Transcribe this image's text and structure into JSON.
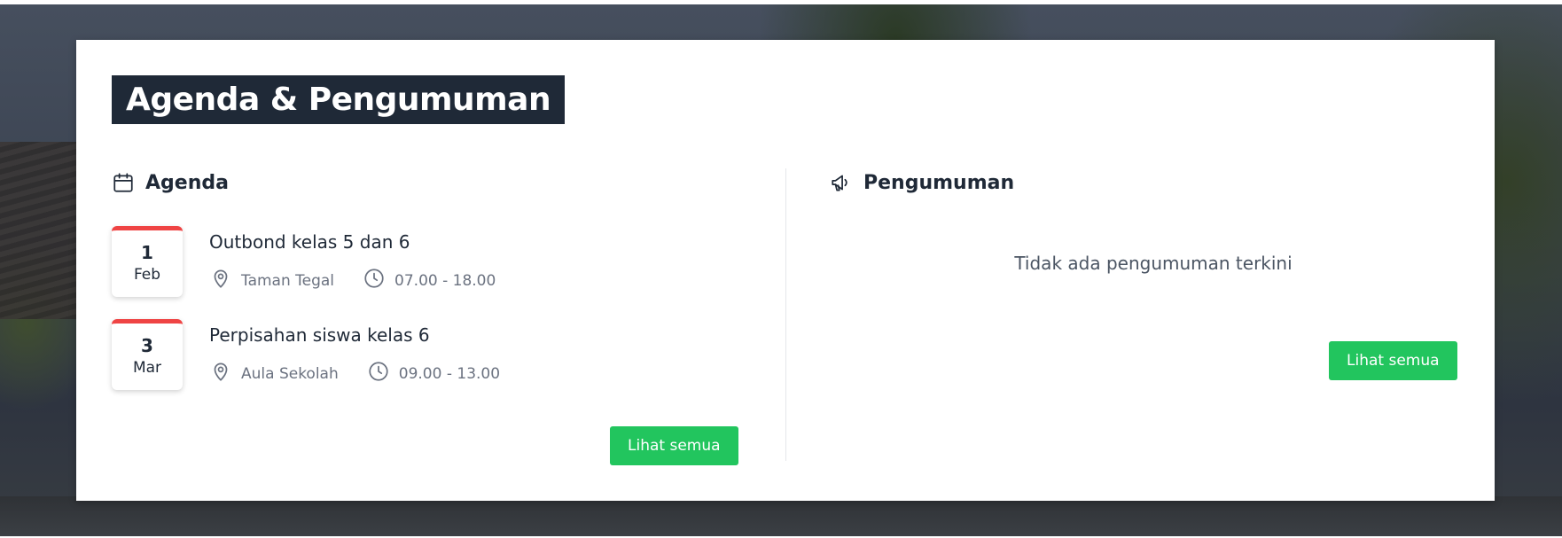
{
  "section_title": "Agenda & Pengumuman",
  "agenda": {
    "heading": "Agenda",
    "icon": "calendar-icon",
    "items": [
      {
        "day": "1",
        "month": "Feb",
        "title": "Outbond kelas 5 dan 6",
        "location": "Taman Tegal",
        "time": "07.00 - 18.00"
      },
      {
        "day": "3",
        "month": "Mar",
        "title": "Perpisahan siswa kelas 6",
        "location": "Aula Sekolah",
        "time": "09.00 - 13.00"
      }
    ],
    "button_label": "Lihat semua"
  },
  "pengumuman": {
    "heading": "Pengumuman",
    "icon": "megaphone-icon",
    "empty_text": "Tidak ada pengumuman terkini",
    "button_label": "Lihat semua"
  },
  "colors": {
    "title_bg": "#1f2937",
    "accent_red": "#ef4444",
    "button_green": "#22c55e"
  }
}
